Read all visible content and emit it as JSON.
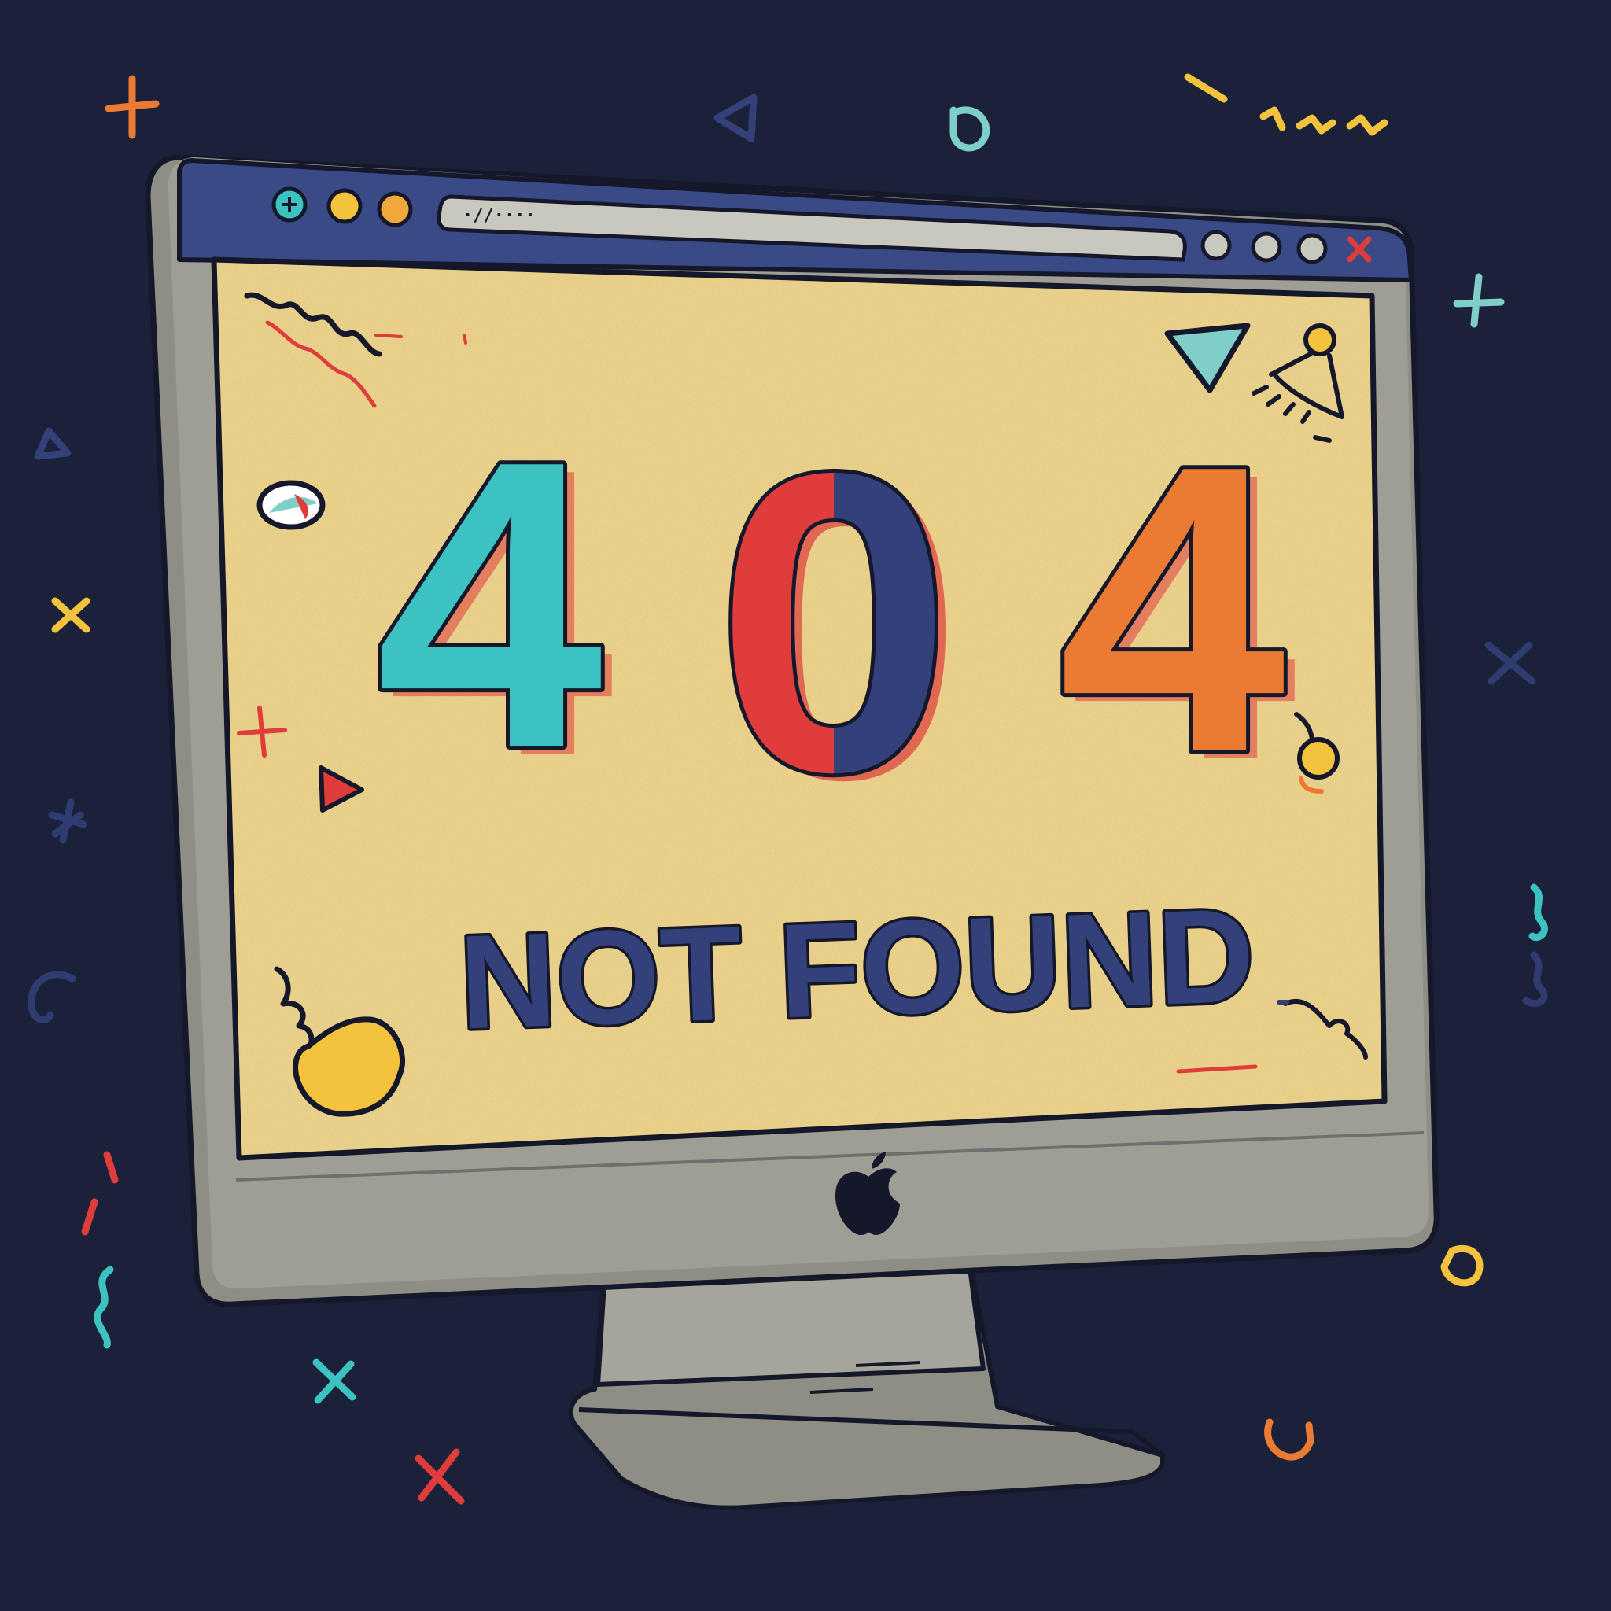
{
  "browser": {
    "address_bar_text": "·//····",
    "window_controls": [
      "add-icon",
      "minimize-icon",
      "maximize-icon"
    ],
    "right_controls": [
      "circle-icon",
      "circle-icon",
      "circle-icon",
      "close-icon"
    ]
  },
  "error": {
    "code_digits": [
      "4",
      "0",
      "4"
    ],
    "message": "NOT FOUND"
  },
  "colors": {
    "background": "#1a2138",
    "screen": "#f1d890",
    "bezel": "#9c9c92",
    "toolbar": "#3a4a86",
    "teal": "#3cc2c0",
    "red": "#e03c3c",
    "navy": "#33407a",
    "orange": "#eb7a32",
    "yellow": "#f3c33d",
    "outline": "#15182a"
  },
  "device": {
    "logo_icon": "apple-logo-icon"
  }
}
